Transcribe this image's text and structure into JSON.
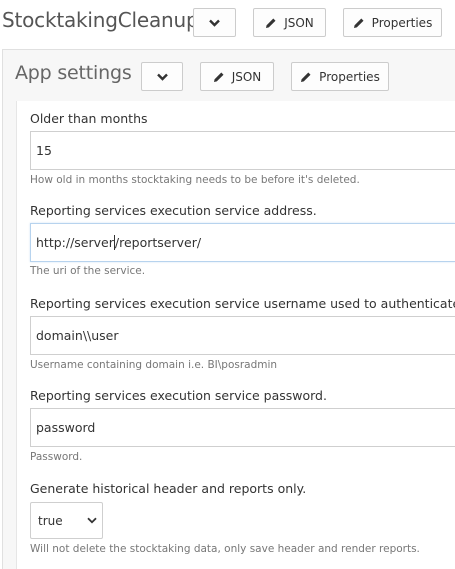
{
  "header": {
    "title": "StocktakingCleanup",
    "json_label": "JSON",
    "properties_label": "Properties"
  },
  "section": {
    "title": "App settings",
    "json_label": "JSON",
    "properties_label": "Properties"
  },
  "fields": [
    {
      "label": "Older than months",
      "value": "15",
      "help": "How old in months stocktaking needs to be before it's deleted."
    },
    {
      "label": "Reporting services execution service address.",
      "value_before_caret": "http://server",
      "value_after_caret": "/reportserver/",
      "help": "The uri of the service."
    },
    {
      "label": "Reporting services execution service username used to authenticate.",
      "value": "domain\\\\user",
      "help": "Username containing domain i.e. BI\\posradmin"
    },
    {
      "label": "Reporting services execution service password.",
      "value": "password",
      "help": "Password."
    },
    {
      "label": "Generate historical header and reports only.",
      "selected": "true",
      "help": "Will not delete the stocktaking data, only save header and render reports."
    }
  ],
  "icons": {
    "dropdown": "chevron-down-icon",
    "edit": "pencil-icon"
  }
}
